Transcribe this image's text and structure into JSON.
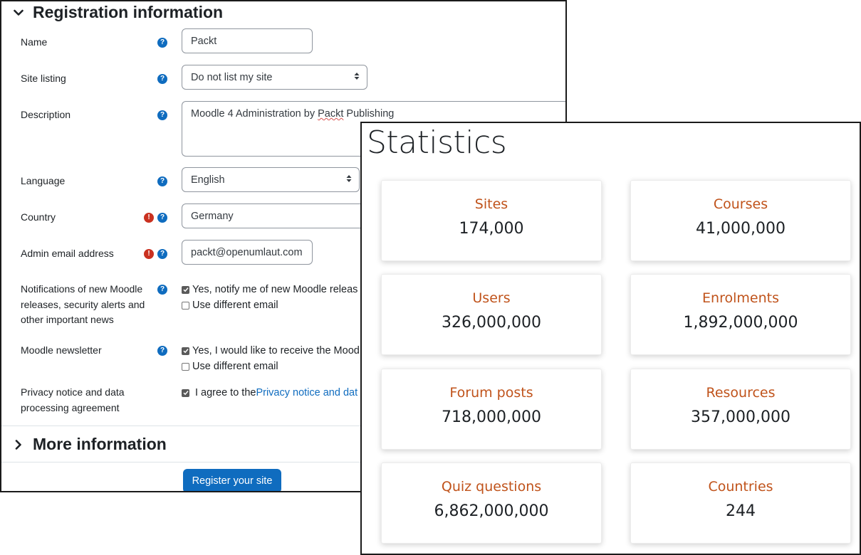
{
  "registration": {
    "section_title": "Registration information",
    "fields": {
      "name": {
        "label": "Name",
        "value": "Packt"
      },
      "site_listing": {
        "label": "Site listing",
        "value": "Do not list my site"
      },
      "description": {
        "label": "Description",
        "value_prefix": "Moodle 4 Administration by ",
        "value_misspelled": "Packt",
        "value_suffix": " Publishing"
      },
      "language": {
        "label": "Language",
        "value": "English"
      },
      "country": {
        "label": "Country",
        "value": "Germany"
      },
      "admin_email": {
        "label": "Admin email address",
        "value": "packt@openumlaut.com"
      },
      "notifications": {
        "label": "Notifications of new Moodle releases, security alerts and other important news",
        "option_notify": "Yes, notify me of new Moodle releas",
        "option_different_email": "Use different email"
      },
      "newsletter": {
        "label": "Moodle newsletter",
        "option_receive": "Yes, I would like to receive the Mood",
        "option_different_email": "Use different email"
      },
      "privacy": {
        "label": "Privacy notice and data processing agreement",
        "agree_prefix": "I agree to the ",
        "agree_link": "Privacy notice and dat"
      }
    },
    "more_info_title": "More information",
    "register_button": "Register your site",
    "icons": {
      "help": "?",
      "required": "!"
    }
  },
  "statistics": {
    "title": "Statistics",
    "cards": [
      {
        "label": "Sites",
        "value": "174,000"
      },
      {
        "label": "Courses",
        "value": "41,000,000"
      },
      {
        "label": "Users",
        "value": "326,000,000"
      },
      {
        "label": "Enrolments",
        "value": "1,892,000,000"
      },
      {
        "label": "Forum posts",
        "value": "718,000,000"
      },
      {
        "label": "Resources",
        "value": "357,000,000"
      },
      {
        "label": "Quiz questions",
        "value": "6,862,000,000"
      },
      {
        "label": "Countries",
        "value": "244"
      }
    ]
  },
  "colors": {
    "primary": "#0f6cbf",
    "required": "#ca3120",
    "stat_label": "#c0531b"
  }
}
